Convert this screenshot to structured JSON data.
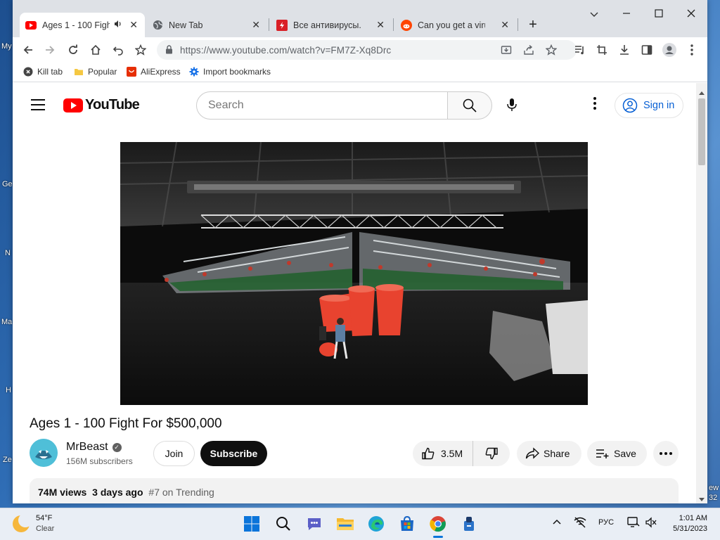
{
  "desktop": {
    "labels": [
      "My",
      "Ge",
      "N",
      "Ma",
      "H",
      "Ze",
      "ew",
      "32"
    ]
  },
  "browser": {
    "tabs": [
      {
        "title": "Ages 1 - 100 Figh",
        "icon": "youtube-icon",
        "audio": true,
        "active": true
      },
      {
        "title": "New Tab",
        "icon": "globe-icon",
        "active": false
      },
      {
        "title": "Все антивирусы. Ска",
        "icon": "antivirus-site-icon",
        "active": false
      },
      {
        "title": "Can you get a virus fr",
        "icon": "reddit-icon",
        "active": false
      }
    ],
    "new_tab": "+",
    "url": "https://www.youtube.com/watch?v=FM7Z-Xq8Drc",
    "bookmarks": [
      {
        "label": "Kill tab",
        "icon": "kill-tab-icon"
      },
      {
        "label": "Popular",
        "icon": "folder-icon"
      },
      {
        "label": "AliExpress",
        "icon": "aliexpress-icon"
      },
      {
        "label": "Import bookmarks",
        "icon": "gear-icon"
      }
    ]
  },
  "youtube": {
    "logo_text": "YouTube",
    "search_placeholder": "Search",
    "sign_in": "Sign in",
    "video_title": "Ages 1 - 100 Fight For $500,000",
    "channel": {
      "name": "MrBeast",
      "subscribers": "156M subscribers",
      "verified": true
    },
    "join_label": "Join",
    "subscribe_label": "Subscribe",
    "likes": "3.5M",
    "share_label": "Share",
    "save_label": "Save",
    "views": "74M views",
    "uploaded": "3 days ago",
    "trending": "#7 on Trending"
  },
  "taskbar": {
    "weather_temp": "54°F",
    "weather_cond": "Clear",
    "language": "РУС",
    "time": "1:01 AM",
    "date": "5/31/2023",
    "apps": [
      "start-icon",
      "search-icon",
      "teams-chat-icon",
      "file-explorer-icon",
      "edge-icon",
      "microsoft-store-icon",
      "chrome-icon",
      "app-icon"
    ]
  },
  "colors": {
    "youtube_red": "#ff0000",
    "link_blue": "#065fd4",
    "chrome_tabstrip": "#dee1e6"
  }
}
